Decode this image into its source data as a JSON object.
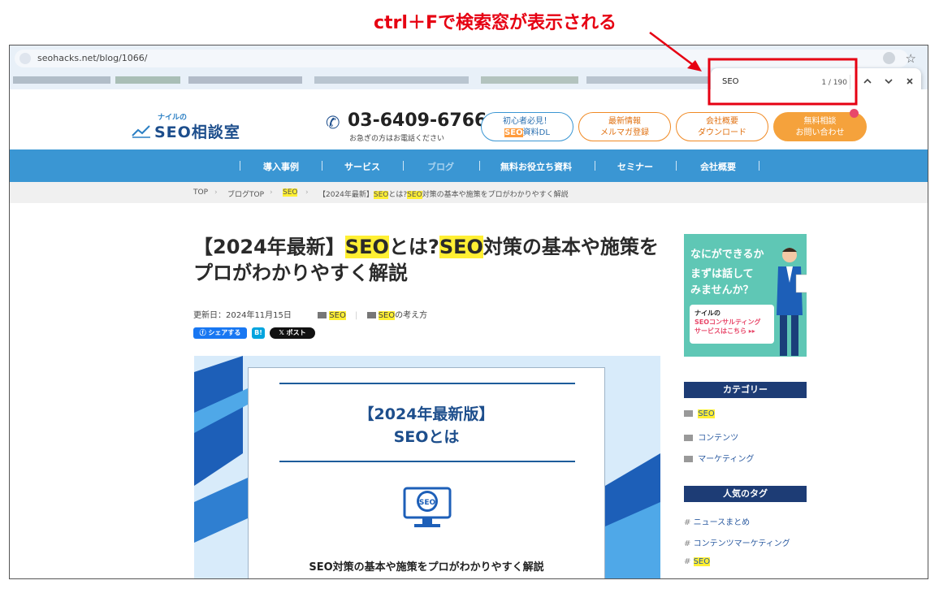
{
  "annotation": {
    "text": "ctrl＋Fで検索窓が表示される",
    "color": "#e60012"
  },
  "browser": {
    "url": "seohacks.net/blog/1066/",
    "find_bar": {
      "query": "SEO",
      "count": "1 / 190",
      "prev_icon": "chevron-up-icon",
      "next_icon": "chevron-down-icon",
      "close_icon": "close-icon"
    }
  },
  "header": {
    "logo_sub": "ナイルの",
    "logo_main": "SEO相談室",
    "phone": "03-6409-6766",
    "phone_note": "お急ぎの方はお電話ください",
    "buttons": [
      {
        "line1": "初心者必見！",
        "line2_hl": "SEO",
        "line2_rest": "資料DL",
        "color": "#3a96d3"
      },
      {
        "line1": "最新情報",
        "line2": "メルマガ登録",
        "color": "#f08a24"
      },
      {
        "line1": "会社概要",
        "line2": "ダウンロード",
        "color": "#f08a24"
      },
      {
        "line1": "無料相談",
        "line2": "お問い合わせ",
        "color": "#f08a24"
      }
    ]
  },
  "nav": {
    "items": [
      "導入事例",
      "サービス",
      "ブログ",
      "無料お役立ち資料",
      "セミナー",
      "会社概要"
    ]
  },
  "breadcrumb": {
    "top": "TOP",
    "blog_top": "ブログTOP",
    "seo": "SEO",
    "current_pre": "【2024年最新】",
    "current_hl1": "SEO",
    "current_mid": "とは?",
    "current_hl2": "SEO",
    "current_rest": "対策の基本や施策をプロがわかりやすく解説",
    "sep": "›"
  },
  "article": {
    "title_pre": "【2024年最新】",
    "title_hl1": "SEO",
    "title_mid": "とは?",
    "title_hl2": "SEO",
    "title_rest": "対策の基本や施策をプロがわかりやすく解説",
    "updated": "更新日：2024年11月15日",
    "cat1": "SEO",
    "cat2_hl": "SEO",
    "cat2_rest": "の考え方",
    "share_fb": "シェアする",
    "share_hb": "B!",
    "share_x": "ポスト",
    "hero": {
      "t1": "【2024年最新版】",
      "t2": "SEOとは",
      "icon_label": "SEO",
      "sub": "SEO対策の基本や施策をプロがわかりやすく解説"
    }
  },
  "sidebar": {
    "ad": {
      "line1": "なにができるか",
      "line2": "まずは話して",
      "line3": "みませんか？",
      "box1": "ナイルの",
      "box2": "SEOコンサルティング",
      "box3": "サービスはこちら ▸▸"
    },
    "category_head": "カテゴリー",
    "categories": [
      "SEO",
      "コンテンツ",
      "マーケティング"
    ],
    "tags_head": "人気のタグ",
    "tags": [
      "ニュースまとめ",
      "コンテンツマーケティング",
      "SEO"
    ]
  }
}
